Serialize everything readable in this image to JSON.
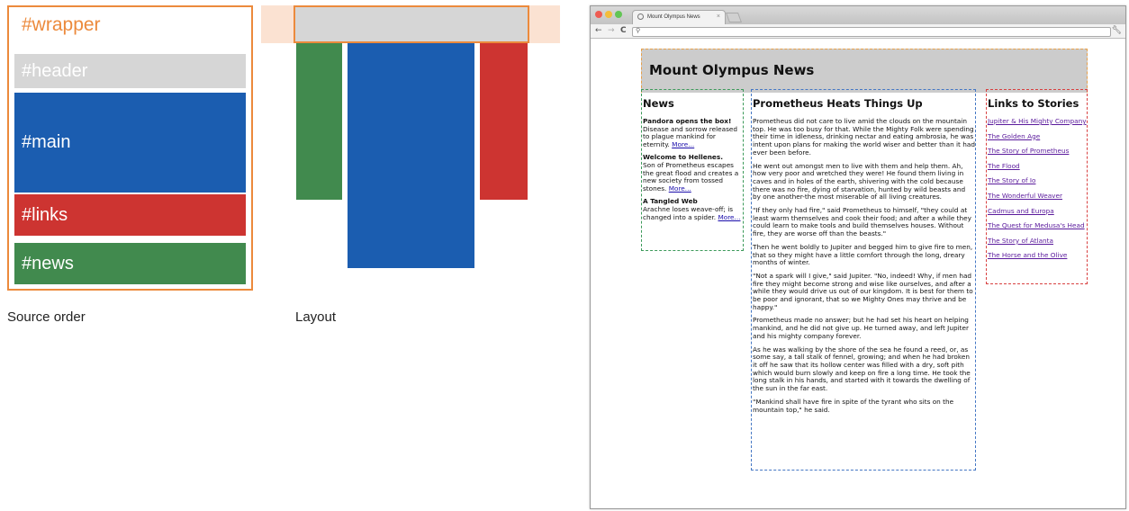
{
  "diagram_source_order": {
    "caption": "Source order",
    "wrapper_label": "#wrapper",
    "boxes": {
      "header": "#header",
      "main": "#main",
      "links": "#links",
      "news": "#news"
    }
  },
  "diagram_layout": {
    "caption": "Layout"
  },
  "colors": {
    "wrapper": "#ec8a3c",
    "header": "#d6d6d6",
    "main": "#1b5db0",
    "links": "#cd3431",
    "news": "#418a4e"
  },
  "browser": {
    "tab_title": "Mount Olympus News",
    "tab_close": "×",
    "nav_back": "←",
    "nav_forward": "→",
    "nav_reload": "C",
    "omnibox_value": "",
    "page": {
      "header_title": "Mount Olympus News",
      "news": {
        "heading": "News",
        "items": [
          {
            "title": "Pandora opens the box!",
            "body": "Disease and sorrow released to plague mankind for eternity.",
            "more": "More..."
          },
          {
            "title": "Welcome to Hellenes.",
            "body": "Son of Prometheus escapes the great flood and creates a new society from tossed stones.",
            "more": "More..."
          },
          {
            "title": "A Tangled Web",
            "body": "Arachne loses weave-off; is changed into a spider.",
            "more": "More..."
          }
        ]
      },
      "main": {
        "heading": "Prometheus Heats Things Up",
        "paragraphs": [
          "Prometheus did not care to live amid the clouds on the mountain top. He was too busy for that. While the Mighty Folk were spending their time in idleness, drinking nectar and eating ambrosia, he was intent upon plans for making the world wiser and better than it had ever been before.",
          "He went out amongst men to live with them and help them. Ah, how very poor and wretched they were! He found them living in caves and in holes of the earth, shivering with the cold because there was no fire, dying of starvation, hunted by wild beasts and by one another-the most miserable of all living creatures.",
          "\"If they only had fire,\" said Prometheus to himself, \"they could at least warm themselves and cook their food; and after a while they could learn to make tools and build themselves houses. Without fire, they are worse off than the beasts.\"",
          "Then he went boldly to Jupiter and begged him to give fire to men, that so they might have a little comfort through the long, dreary months of winter.",
          "\"Not a spark will I give,\" said Jupiter. \"No, indeed! Why, if men had fire they might become strong and wise like ourselves, and after a while they would drive us out of our kingdom. It is best for them to be poor and ignorant, that so we Mighty Ones may thrive and be happy.\"",
          "Prometheus made no answer; but he had set his heart on helping mankind, and he did not give up. He turned away, and left Jupiter and his mighty company forever.",
          "As he was walking by the shore of the sea he found a reed, or, as some say, a tall stalk of fennel, growing; and when he had broken it off he saw that its hollow center was filled with a dry, soft pith which would burn slowly and keep on fire a long time. He took the long stalk in his hands, and started with it towards the dwelling of the sun in the far east.",
          "\"Mankind shall have fire in spite of the tyrant who sits on the mountain top,\" he said."
        ]
      },
      "links": {
        "heading": "Links to Stories",
        "items": [
          "Jupiter & His Mighty Company",
          "The Golden Age",
          "The Story of Prometheus",
          "The Flood",
          "The Story of Io",
          "The Wonderful Weaver",
          "Cadmus and Europa",
          "The Quest for Medusa's Head",
          "The Story of Atlanta",
          "The Horse and the Olive"
        ]
      }
    }
  }
}
